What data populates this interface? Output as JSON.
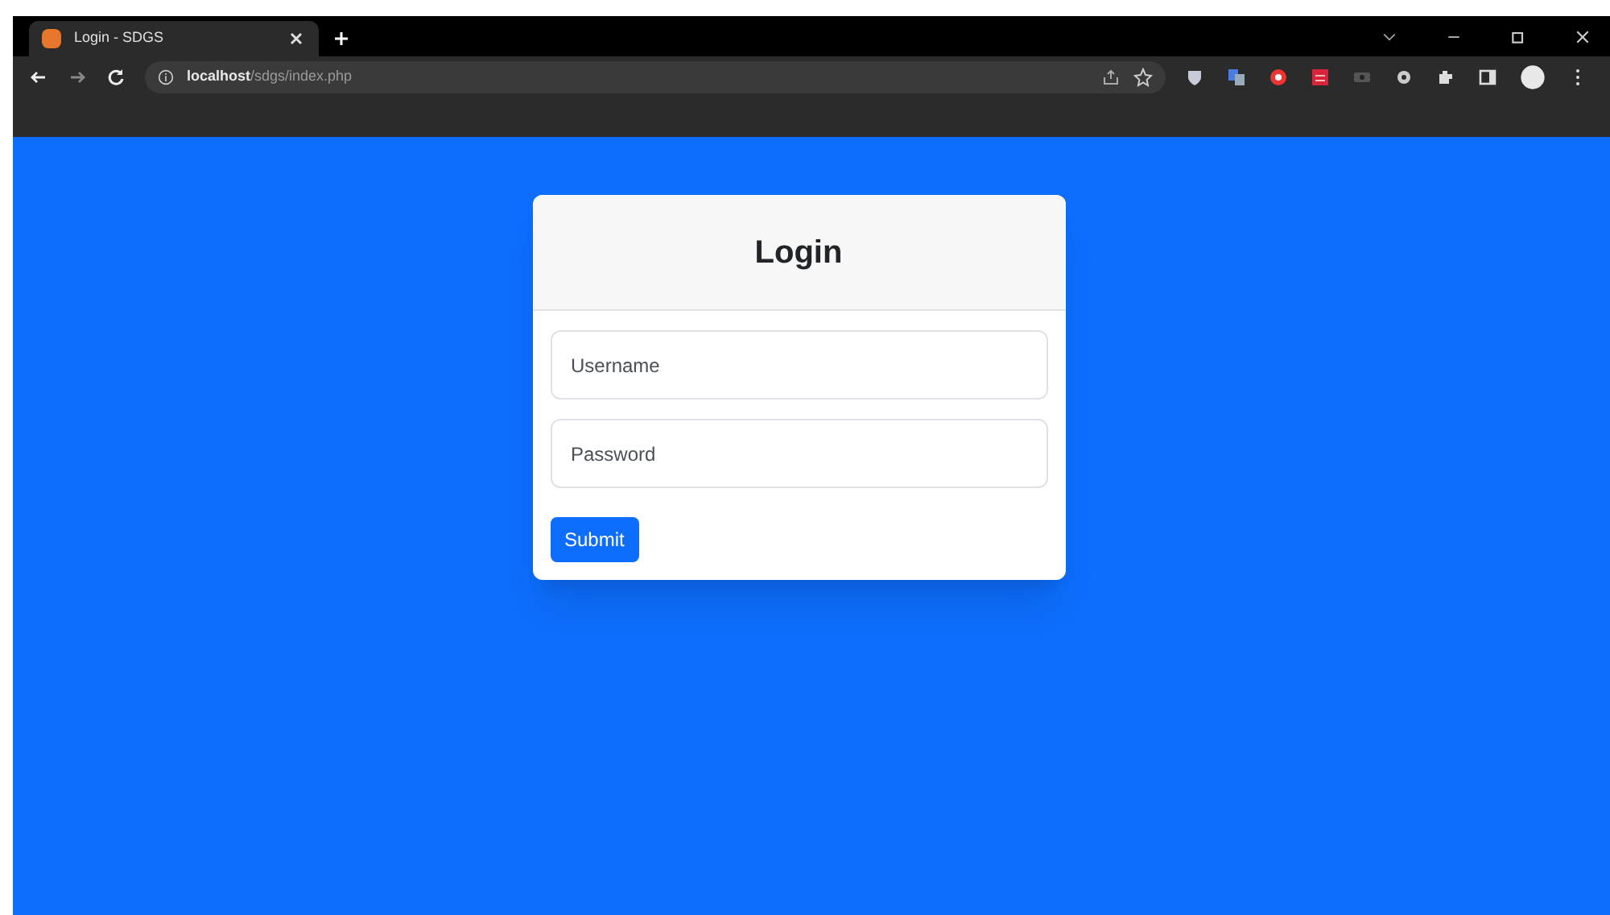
{
  "browser": {
    "tab": {
      "title": "Login - SDGS",
      "selected": true
    },
    "url": "**localhost**/sdgs/index.php"
  },
  "login": {
    "title": "Login",
    "fields": [
      {
        "placeholder": "Username"
      },
      {
        "placeholder": "Password"
      }
    ],
    "submit": "Submit"
  }
}
